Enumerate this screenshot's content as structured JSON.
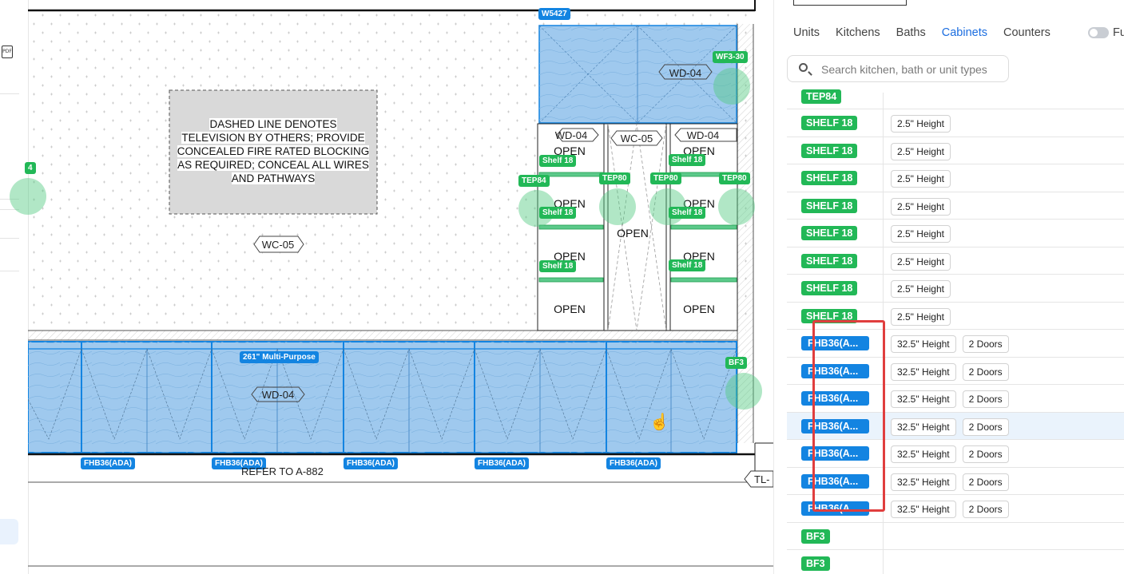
{
  "drawing": {
    "note_lines": [
      "DASHED LINE DENOTES",
      "TELEVISION BY OTHERS; PROVIDE",
      "CONCEALED FIRE RATED BLOCKING",
      "AS REQUIRED; CONCEAL ALL WIRES",
      "AND PATHWAYS"
    ],
    "labels": {
      "wc05_main": "WC-05",
      "wd04_upper": "WD-04",
      "wd04_left": "WD-04",
      "wc05_mid": "WC-05",
      "wd04_right": "WD-04",
      "wd04_base": "WD-04",
      "refer": "REFER TO A-882",
      "tl": "TL-"
    },
    "open_label": "OPEN",
    "tags": {
      "w5427": "W5427",
      "wf330": "WF3-30",
      "tep84": "TEP84",
      "tep80_a": "TEP80",
      "tep80_b": "TEP80",
      "tep80_c": "TEP80",
      "shelf18": "Shelf 18",
      "multipurpose": "261\" Multi-Purpose",
      "bf3": "BF3",
      "fhb_base": "FHB36(ADA)",
      "left_partial": "4"
    }
  },
  "panel": {
    "tabs": [
      "Units",
      "Kitchens",
      "Baths",
      "Cabinets",
      "Counters"
    ],
    "active_tab": "Cabinets",
    "toggle_label": "Fu",
    "search_placeholder": "Search kitchen, bath or unit types",
    "rows": [
      {
        "name": "TEP84",
        "color": "green",
        "attrs": [],
        "cut": true
      },
      {
        "name": "SHELF 18",
        "color": "green",
        "attrs": [
          "2.5\" Height"
        ]
      },
      {
        "name": "SHELF 18",
        "color": "green",
        "attrs": [
          "2.5\" Height"
        ]
      },
      {
        "name": "SHELF 18",
        "color": "green",
        "attrs": [
          "2.5\" Height"
        ]
      },
      {
        "name": "SHELF 18",
        "color": "green",
        "attrs": [
          "2.5\" Height"
        ]
      },
      {
        "name": "SHELF 18",
        "color": "green",
        "attrs": [
          "2.5\" Height"
        ]
      },
      {
        "name": "SHELF 18",
        "color": "green",
        "attrs": [
          "2.5\" Height"
        ]
      },
      {
        "name": "SHELF 18",
        "color": "green",
        "attrs": [
          "2.5\" Height"
        ]
      },
      {
        "name": "SHELF 18",
        "color": "green",
        "attrs": [
          "2.5\" Height"
        ]
      },
      {
        "name": "FHB36(A...",
        "color": "blue",
        "attrs": [
          "32.5\" Height",
          "2 Doors"
        ]
      },
      {
        "name": "FHB36(A...",
        "color": "blue",
        "attrs": [
          "32.5\" Height",
          "2 Doors"
        ]
      },
      {
        "name": "FHB36(A...",
        "color": "blue",
        "attrs": [
          "32.5\" Height",
          "2 Doors"
        ]
      },
      {
        "name": "FHB36(A...",
        "color": "blue",
        "attrs": [
          "32.5\" Height",
          "2 Doors"
        ],
        "highlight": true
      },
      {
        "name": "FHB36(A...",
        "color": "blue",
        "attrs": [
          "32.5\" Height",
          "2 Doors"
        ]
      },
      {
        "name": "FHB36(A...",
        "color": "blue",
        "attrs": [
          "32.5\" Height",
          "2 Doors"
        ]
      },
      {
        "name": "FHB36(A...",
        "color": "blue",
        "attrs": [
          "32.5\" Height",
          "2 Doors"
        ]
      },
      {
        "name": "BF3",
        "color": "green",
        "attrs": []
      },
      {
        "name": "BF3",
        "color": "green",
        "attrs": []
      }
    ]
  },
  "colors": {
    "accent": "#1c6ee0",
    "green_tag": "#22b857",
    "blue_tag": "#1384e1",
    "cabinet_fill": "#9fc9ee",
    "highlight_border": "#e03e3e"
  }
}
